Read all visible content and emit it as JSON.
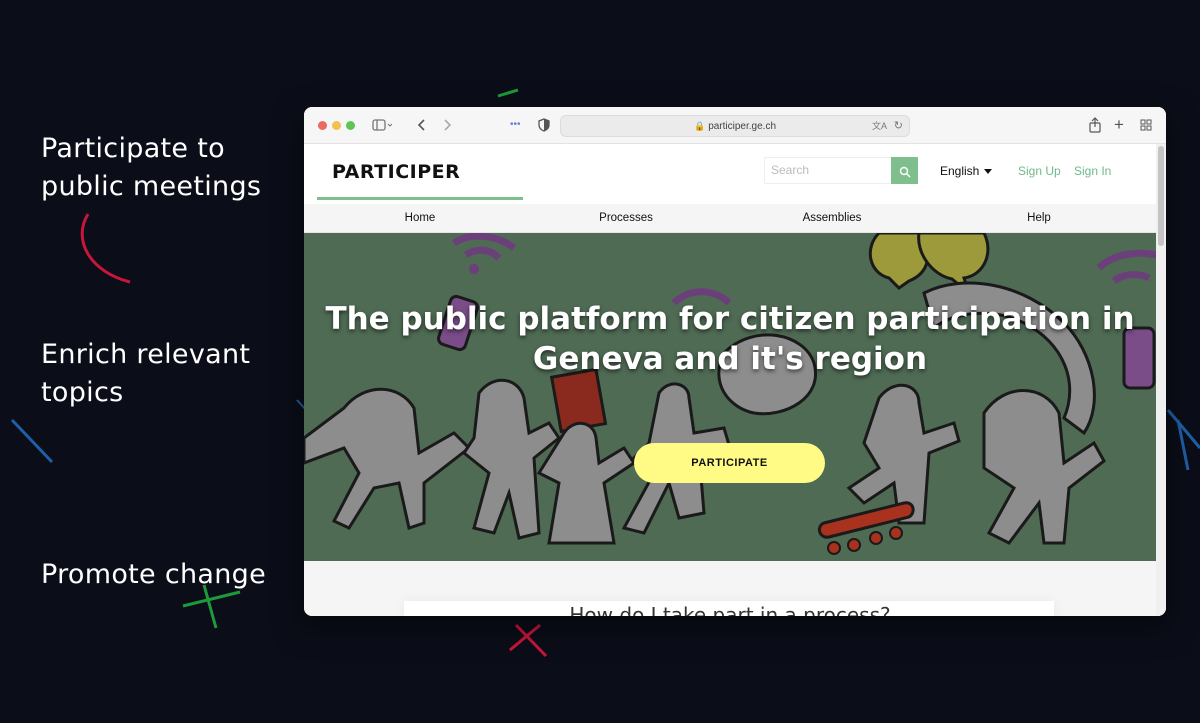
{
  "side_texts": [
    "Participate to public meetings",
    "Enrich relevant topics",
    "Promote change"
  ],
  "browser": {
    "url": "participer.ge.ch"
  },
  "site": {
    "logo": "PARTICIPER",
    "search_placeholder": "Search",
    "language": "English",
    "sign_up": "Sign Up",
    "sign_in": "Sign In",
    "nav": [
      "Home",
      "Processes",
      "Assemblies",
      "Help"
    ],
    "hero_title": "The public platform for citizen participation in Geneva and it's region",
    "cta": "PARTICIPATE",
    "section_heading": "How do I take part in a process?"
  },
  "colors": {
    "accent_green": "#7fbf8e",
    "cta_yellow": "#fffb85",
    "hero_bg": "#4f6b54",
    "page_bg": "#0b0d18"
  },
  "icons": [
    "sidebar-toggle-icon",
    "back-icon",
    "forward-icon",
    "shield-icon",
    "lock-icon",
    "translate-icon",
    "reload-icon",
    "share-icon",
    "new-tab-icon",
    "tab-overview-icon",
    "search-icon",
    "caret-down-icon"
  ]
}
